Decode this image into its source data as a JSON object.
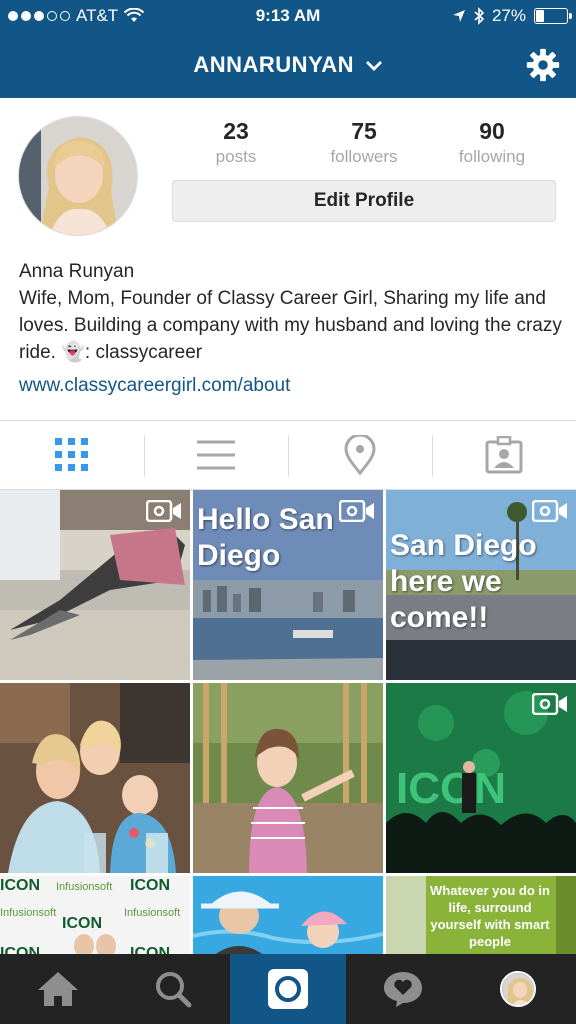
{
  "status_bar": {
    "carrier": "AT&T",
    "time": "9:13 AM",
    "battery": "27%",
    "battery_level": 0.27
  },
  "nav": {
    "username": "ANNARUNYAN ⌄",
    "username_text": "ANNARUNYAN"
  },
  "profile": {
    "posts_count": "23",
    "posts_label": "posts",
    "followers_count": "75",
    "followers_label": "followers",
    "following_count": "90",
    "following_label": "following",
    "edit_button": "Edit Profile",
    "name": "Anna Runyan",
    "bio": "Wife, Mom, Founder of Classy Career Girl, Sharing my life and loves. Building a company with my husband and loving the crazy ride. 👻: classycareer",
    "website": "www.classycareergirl.com/about"
  },
  "tabs": [
    "grid-view",
    "list-view",
    "location-view",
    "tagged-view"
  ],
  "grid": {
    "captions": {
      "post2": "Hello San Diego",
      "post3": "San Diego here we come!!",
      "post9": "Whatever you do in life, surround yourself with smart people",
      "post7_logo": "ICON",
      "post7_brand": "Infusionsoft",
      "post6_logo": "ICON"
    }
  },
  "bottom_nav": [
    "home",
    "search",
    "camera",
    "activity",
    "profile"
  ],
  "colors": {
    "brand": "#125688",
    "bottom_bar": "#232323",
    "link": "#125688"
  }
}
